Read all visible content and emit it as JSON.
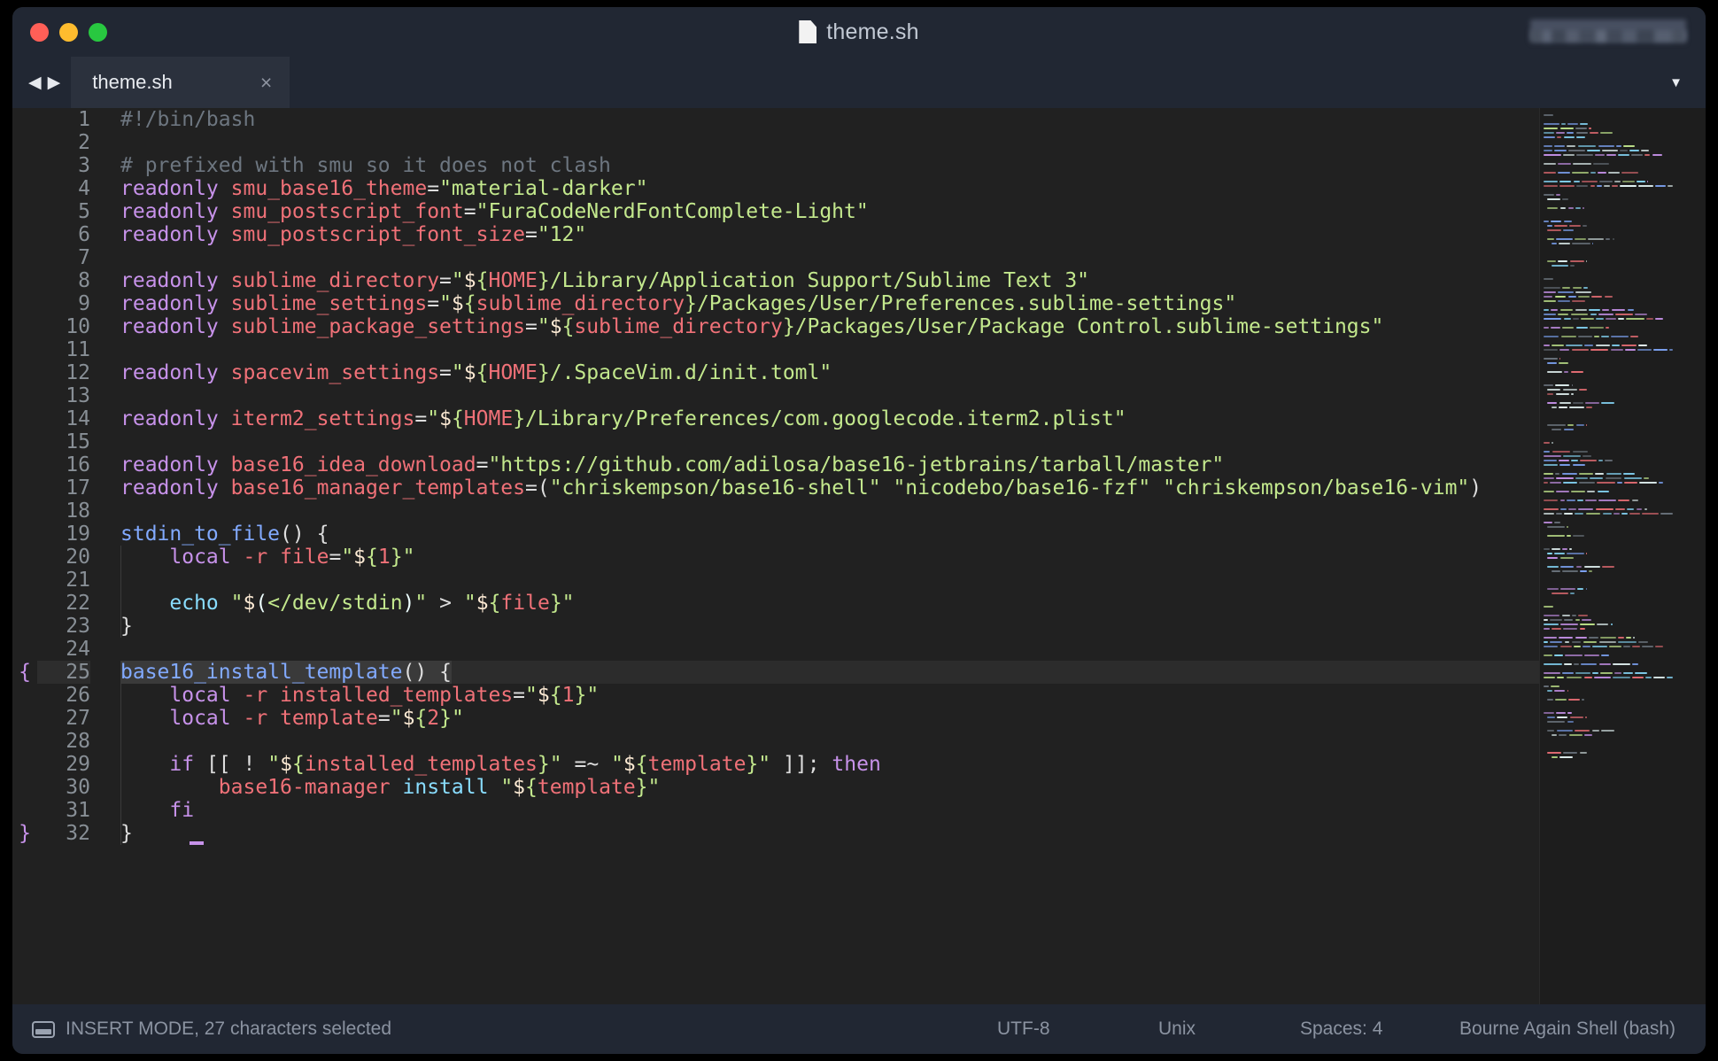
{
  "window": {
    "traffic_lights": [
      "close",
      "minimize",
      "zoom"
    ],
    "title": "theme.sh",
    "title_icon": "file-icon"
  },
  "tabbar": {
    "back_arrow": "◀",
    "forward_arrow": "▶",
    "tab_label": "theme.sh",
    "close_glyph": "×",
    "chevron_glyph": "▼"
  },
  "editor": {
    "language": "Bourne Again Shell (bash)",
    "selected_line": 25,
    "fold_marker": "{",
    "close_fold_marker": "}",
    "line_numbers": [
      1,
      2,
      3,
      4,
      5,
      6,
      7,
      8,
      9,
      10,
      11,
      12,
      13,
      14,
      15,
      16,
      17,
      18,
      19,
      20,
      21,
      22,
      23,
      24,
      25,
      26,
      27,
      28,
      29,
      30,
      31,
      32
    ],
    "lines": [
      "#!/bin/bash",
      "",
      "# prefixed with smu so it does not clash",
      "readonly smu_base16_theme=\"material-darker\"",
      "readonly smu_postscript_font=\"FuraCodeNerdFontComplete-Light\"",
      "readonly smu_postscript_font_size=\"12\"",
      "",
      "readonly sublime_directory=\"${HOME}/Library/Application Support/Sublime Text 3\"",
      "readonly sublime_settings=\"${sublime_directory}/Packages/User/Preferences.sublime-settings\"",
      "readonly sublime_package_settings=\"${sublime_directory}/Packages/User/Package Control.sublime-settings\"",
      "",
      "readonly spacevim_settings=\"${HOME}/.SpaceVim.d/init.toml\"",
      "",
      "readonly iterm2_settings=\"${HOME}/Library/Preferences/com.googlecode.iterm2.plist\"",
      "",
      "readonly base16_idea_download=\"https://github.com/adilosa/base16-jetbrains/tarball/master\"",
      "readonly base16_manager_templates=(\"chriskempson/base16-shell\" \"nicodebo/base16-fzf\" \"chriskempson/base16-vim\")",
      "",
      "stdin_to_file() {",
      "    local -r file=\"${1}\"",
      "",
      "    echo \"$(</dev/stdin)\" > \"${file}\"",
      "}",
      "",
      "base16_install_template() {",
      "    local -r installed_templates=\"${1}\"",
      "    local -r template=\"${2}\"",
      "",
      "    if [[ ! \"${installed_templates}\" =~ \"${template}\" ]]; then",
      "        base16-manager install \"${template}\"",
      "    fi",
      "}"
    ]
  },
  "statusbar": {
    "mode_icon": "keyboard-icon",
    "mode_text": "INSERT MODE, 27 characters selected",
    "encoding": "UTF-8",
    "line_endings": "Unix",
    "indentation": "Spaces: 4",
    "syntax": "Bourne Again Shell (bash)"
  },
  "colors": {
    "background": "#212121",
    "chrome": "#212733",
    "tab_active": "#2b313d",
    "comment": "#6d7680",
    "keyword": "#c792ea",
    "variable": "#f07178",
    "string": "#c3e88d",
    "function": "#82aaff",
    "builtin": "#89ddff",
    "foreground": "#eeffff",
    "traffic_red": "#ff5f57",
    "traffic_yellow": "#febc2e",
    "traffic_green": "#28c840"
  }
}
